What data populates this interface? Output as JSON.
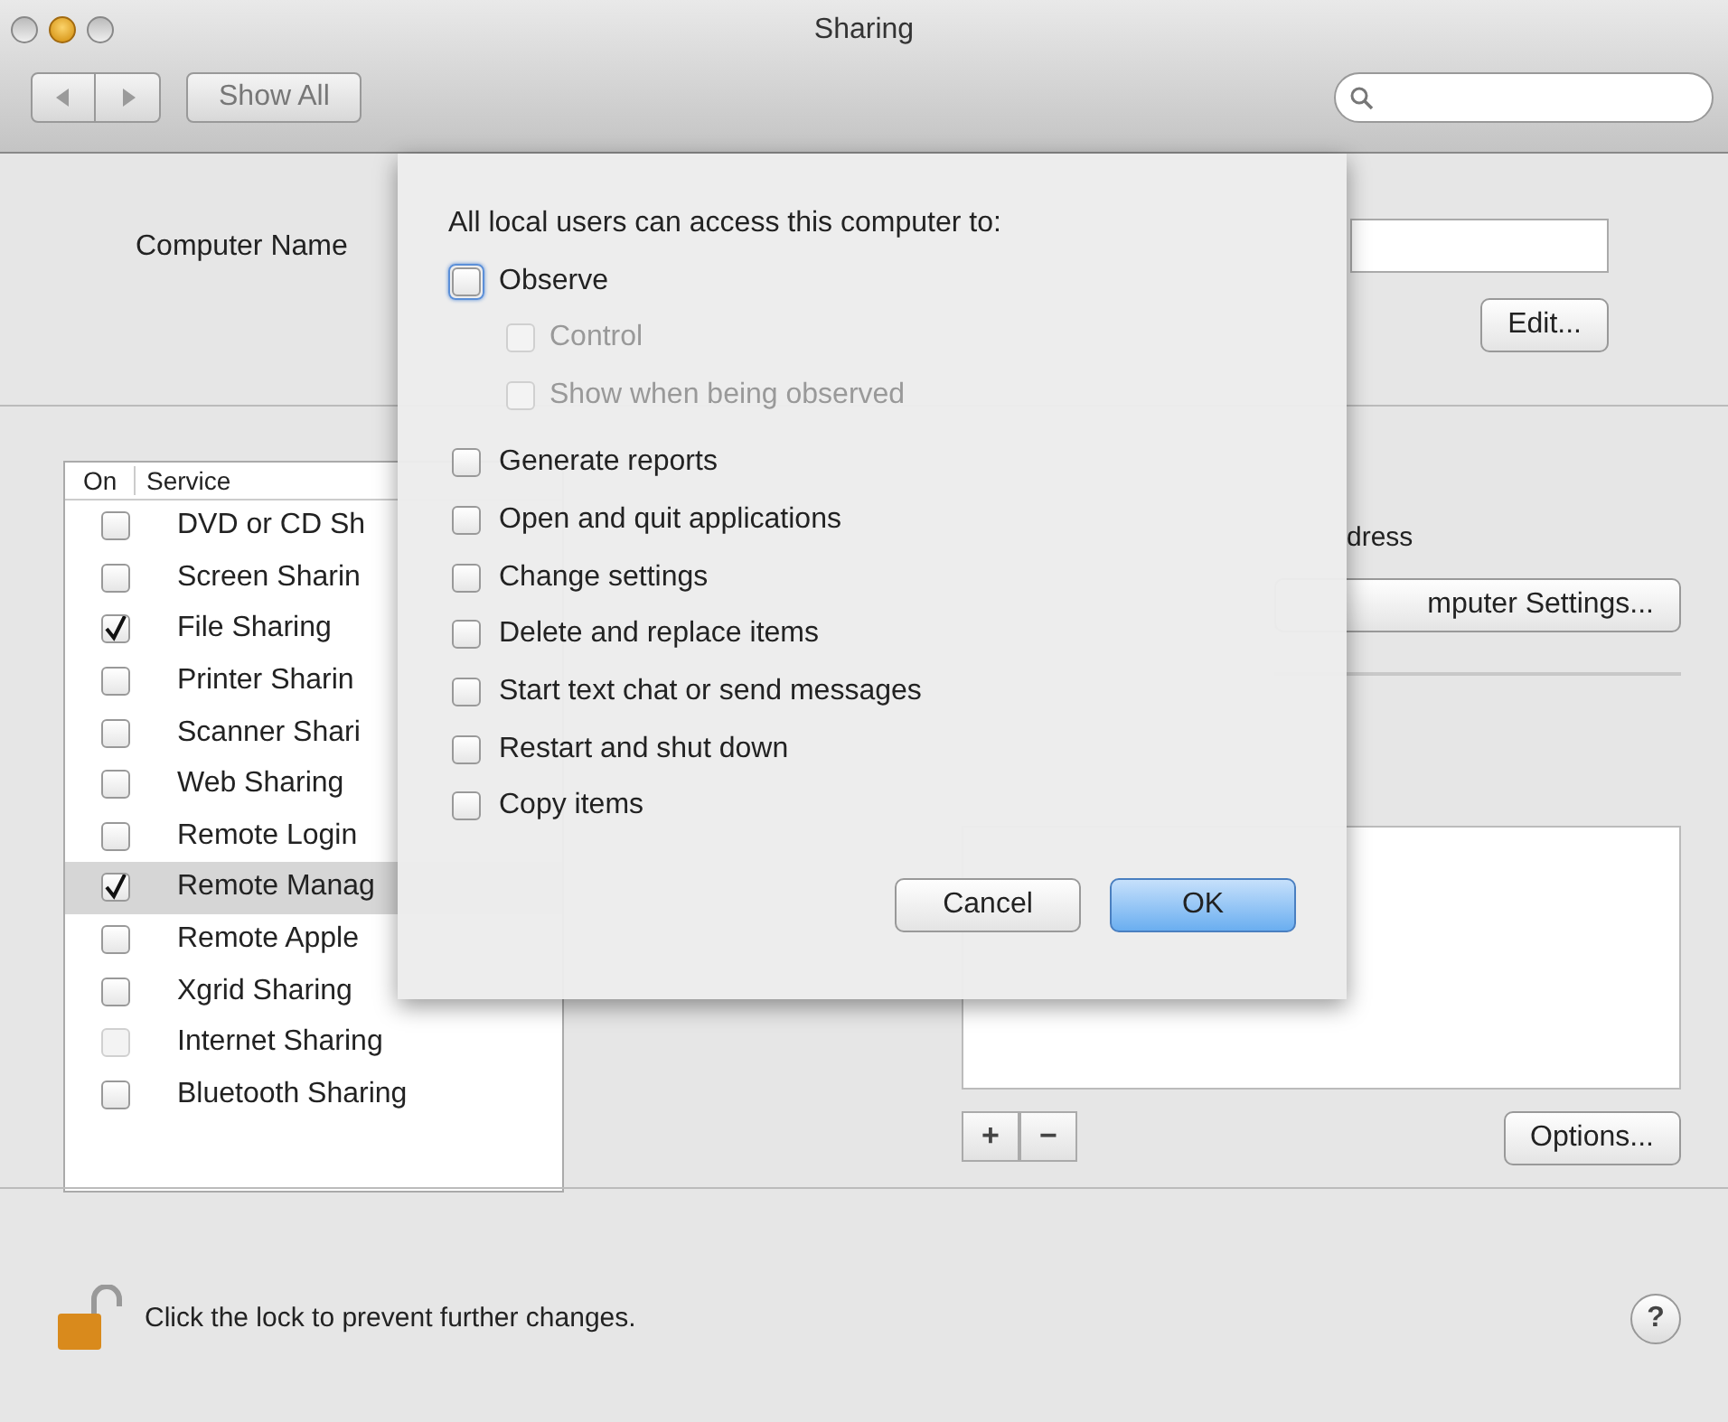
{
  "window": {
    "title": "Sharing"
  },
  "toolbar": {
    "show_all": "Show All"
  },
  "computer_name": {
    "label": "Computer Name",
    "edit_button": "Edit..."
  },
  "services": {
    "columns": [
      "On",
      "Service"
    ],
    "rows": [
      {
        "name": "DVD or CD Sh",
        "on": false,
        "selected": false,
        "disabled": false
      },
      {
        "name": "Screen Sharin",
        "on": false,
        "selected": false,
        "disabled": false
      },
      {
        "name": "File Sharing",
        "on": true,
        "selected": false,
        "disabled": false
      },
      {
        "name": "Printer Sharin",
        "on": false,
        "selected": false,
        "disabled": false
      },
      {
        "name": "Scanner Shari",
        "on": false,
        "selected": false,
        "disabled": false
      },
      {
        "name": "Web Sharing",
        "on": false,
        "selected": false,
        "disabled": false
      },
      {
        "name": "Remote Login",
        "on": false,
        "selected": false,
        "disabled": false
      },
      {
        "name": "Remote Manag",
        "on": true,
        "selected": true,
        "disabled": false
      },
      {
        "name": "Remote Apple",
        "on": false,
        "selected": false,
        "disabled": false
      },
      {
        "name": "Xgrid Sharing",
        "on": false,
        "selected": false,
        "disabled": false
      },
      {
        "name": "Internet Sharing",
        "on": false,
        "selected": false,
        "disabled": true
      },
      {
        "name": "Bluetooth Sharing",
        "on": false,
        "selected": false,
        "disabled": false
      }
    ]
  },
  "right_panel": {
    "address_text": "dress",
    "settings_button": "mputer Settings...",
    "add_button": "+",
    "remove_button": "−",
    "options_button": "Options..."
  },
  "footer": {
    "lock_text": "Click the lock to prevent further changes.",
    "help_button": "?"
  },
  "sheet": {
    "heading": "All local users can access this computer to:",
    "options": [
      {
        "label": "Observe",
        "checked": false,
        "disabled": false,
        "focused": true,
        "children": [
          {
            "label": "Control",
            "checked": false,
            "disabled": true
          },
          {
            "label": "Show when being observed",
            "checked": false,
            "disabled": true
          }
        ]
      },
      {
        "label": "Generate reports",
        "checked": false,
        "disabled": false,
        "focused": false
      },
      {
        "label": "Open and quit applications",
        "checked": false,
        "disabled": false,
        "focused": false
      },
      {
        "label": "Change settings",
        "checked": false,
        "disabled": false,
        "focused": false
      },
      {
        "label": "Delete and replace items",
        "checked": false,
        "disabled": false,
        "focused": false
      },
      {
        "label": "Start text chat or send messages",
        "checked": false,
        "disabled": false,
        "focused": false
      },
      {
        "label": "Restart and shut down",
        "checked": false,
        "disabled": false,
        "focused": false
      },
      {
        "label": "Copy items",
        "checked": false,
        "disabled": false,
        "focused": false
      }
    ],
    "buttons": [
      {
        "label": "Cancel",
        "default": false
      },
      {
        "label": "OK",
        "default": true
      }
    ]
  }
}
